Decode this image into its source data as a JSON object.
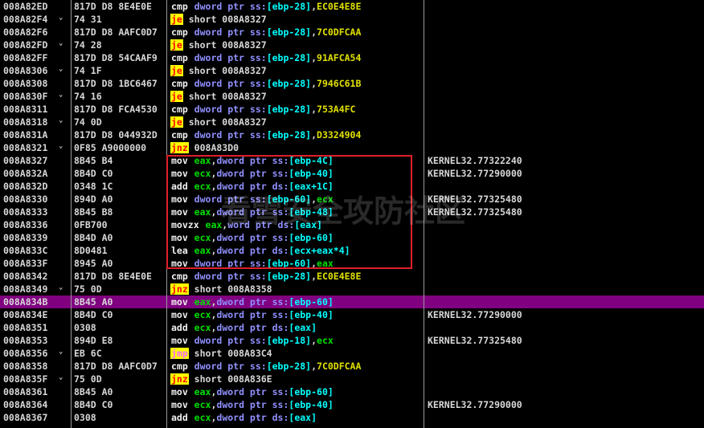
{
  "colors": {
    "background": "#000000",
    "text": "#d8d8d8",
    "selected_row": "#800080",
    "jump_bg": "#ffff00",
    "jump_fg": "#ff0000",
    "jump_alt_fg": "#ff66ff",
    "mov": "#f0f0f0",
    "register": "#00e000",
    "size": "#9090ff",
    "operand": "#00ffff",
    "imm": "#e0e000",
    "annotation_box": "#e0202a"
  },
  "watermark": "看雪安全攻防社区",
  "rows": [
    {
      "addr": "008A82ED",
      "hex": "817D D8 8E4E0E",
      "dis": [
        {
          "t": "cmp",
          "c": "#f0f0f0",
          "k": "mn"
        },
        {
          "t": " "
        },
        {
          "t": "dword ptr ss:",
          "c": "#9090ff"
        },
        {
          "t": "[ebp-28]",
          "c": "#00ffff"
        },
        {
          "t": ",",
          "c": "#d8d8d8"
        },
        {
          "t": "EC0E4E8E",
          "c": "#e0e000"
        }
      ],
      "comment": ""
    },
    {
      "addr": "008A82F4",
      "arrow": "⌄",
      "hex": "74 31",
      "dis": [
        {
          "t": "je",
          "c": "#ff0000",
          "bg": "#ffff00",
          "k": "mn"
        },
        {
          "t": " "
        },
        {
          "t": "short 008A8327",
          "c": "#d8d8d8"
        }
      ],
      "comment": ""
    },
    {
      "addr": "008A82F6",
      "hex": "817D D8 AAFC0D7",
      "dis": [
        {
          "t": "cmp",
          "c": "#f0f0f0",
          "k": "mn"
        },
        {
          "t": " "
        },
        {
          "t": "dword ptr ss:",
          "c": "#9090ff"
        },
        {
          "t": "[ebp-28]",
          "c": "#00ffff"
        },
        {
          "t": ",",
          "c": "#d8d8d8"
        },
        {
          "t": "7C0DFCAA",
          "c": "#e0e000"
        }
      ],
      "comment": ""
    },
    {
      "addr": "008A82FD",
      "arrow": "⌄",
      "hex": "74 28",
      "dis": [
        {
          "t": "je",
          "c": "#ff0000",
          "bg": "#ffff00",
          "k": "mn"
        },
        {
          "t": " "
        },
        {
          "t": "short 008A8327",
          "c": "#d8d8d8"
        }
      ],
      "comment": ""
    },
    {
      "addr": "008A82FF",
      "hex": "817D D8 54CAAF9",
      "dis": [
        {
          "t": "cmp",
          "c": "#f0f0f0",
          "k": "mn"
        },
        {
          "t": " "
        },
        {
          "t": "dword ptr ss:",
          "c": "#9090ff"
        },
        {
          "t": "[ebp-28]",
          "c": "#00ffff"
        },
        {
          "t": ",",
          "c": "#d8d8d8"
        },
        {
          "t": "91AFCA54",
          "c": "#e0e000"
        }
      ],
      "comment": ""
    },
    {
      "addr": "008A8306",
      "arrow": "⌄",
      "hex": "74 1F",
      "dis": [
        {
          "t": "je",
          "c": "#ff0000",
          "bg": "#ffff00",
          "k": "mn"
        },
        {
          "t": " "
        },
        {
          "t": "short 008A8327",
          "c": "#d8d8d8"
        }
      ],
      "comment": ""
    },
    {
      "addr": "008A8308",
      "hex": "817D D8 1BC6467",
      "dis": [
        {
          "t": "cmp",
          "c": "#f0f0f0",
          "k": "mn"
        },
        {
          "t": " "
        },
        {
          "t": "dword ptr ss:",
          "c": "#9090ff"
        },
        {
          "t": "[ebp-28]",
          "c": "#00ffff"
        },
        {
          "t": ",",
          "c": "#d8d8d8"
        },
        {
          "t": "7946C61B",
          "c": "#e0e000"
        }
      ],
      "comment": ""
    },
    {
      "addr": "008A830F",
      "arrow": "⌄",
      "hex": "74 16",
      "dis": [
        {
          "t": "je",
          "c": "#ff0000",
          "bg": "#ffff00",
          "k": "mn"
        },
        {
          "t": " "
        },
        {
          "t": "short 008A8327",
          "c": "#d8d8d8"
        }
      ],
      "comment": ""
    },
    {
      "addr": "008A8311",
      "hex": "817D D8 FCA4530",
      "dis": [
        {
          "t": "cmp",
          "c": "#f0f0f0",
          "k": "mn"
        },
        {
          "t": " "
        },
        {
          "t": "dword ptr ss:",
          "c": "#9090ff"
        },
        {
          "t": "[ebp-28]",
          "c": "#00ffff"
        },
        {
          "t": ",",
          "c": "#d8d8d8"
        },
        {
          "t": "753A4FC",
          "c": "#e0e000"
        }
      ],
      "comment": ""
    },
    {
      "addr": "008A8318",
      "arrow": "⌄",
      "hex": "74 0D",
      "dis": [
        {
          "t": "je",
          "c": "#ff0000",
          "bg": "#ffff00",
          "k": "mn"
        },
        {
          "t": " "
        },
        {
          "t": "short 008A8327",
          "c": "#d8d8d8"
        }
      ],
      "comment": ""
    },
    {
      "addr": "008A831A",
      "hex": "817D D8 044932D",
      "dis": [
        {
          "t": "cmp",
          "c": "#f0f0f0",
          "k": "mn"
        },
        {
          "t": " "
        },
        {
          "t": "dword ptr ss:",
          "c": "#9090ff"
        },
        {
          "t": "[ebp-28]",
          "c": "#00ffff"
        },
        {
          "t": ",",
          "c": "#d8d8d8"
        },
        {
          "t": "D3324904",
          "c": "#e0e000"
        }
      ],
      "comment": ""
    },
    {
      "addr": "008A8321",
      "arrow": "⌄",
      "hex": "0F85 A9000000",
      "dis": [
        {
          "t": "jnz",
          "c": "#ff0000",
          "bg": "#ffff00",
          "k": "mn"
        },
        {
          "t": " "
        },
        {
          "t": "008A83D0",
          "c": "#d8d8d8"
        }
      ],
      "comment": ""
    },
    {
      "addr": "008A8327",
      "hex": "8B45 B4",
      "dis": [
        {
          "t": "mov",
          "c": "#f0f0f0",
          "k": "mn"
        },
        {
          "t": " "
        },
        {
          "t": "eax",
          "c": "#00e000"
        },
        {
          "t": ",",
          "c": "#d8d8d8"
        },
        {
          "t": "dword ptr ss:",
          "c": "#9090ff"
        },
        {
          "t": "[ebp-4C]",
          "c": "#00ffff"
        }
      ],
      "comment": "KERNEL32.77322240"
    },
    {
      "addr": "008A832A",
      "hex": "8B4D C0",
      "dis": [
        {
          "t": "mov",
          "c": "#f0f0f0",
          "k": "mn"
        },
        {
          "t": " "
        },
        {
          "t": "ecx",
          "c": "#00e000"
        },
        {
          "t": ",",
          "c": "#d8d8d8"
        },
        {
          "t": "dword ptr ss:",
          "c": "#9090ff"
        },
        {
          "t": "[ebp-40]",
          "c": "#00ffff"
        }
      ],
      "comment": "KERNEL32.77290000"
    },
    {
      "addr": "008A832D",
      "hex": "0348 1C",
      "dis": [
        {
          "t": "add",
          "c": "#f0f0f0",
          "k": "mn"
        },
        {
          "t": " "
        },
        {
          "t": "ecx",
          "c": "#00e000"
        },
        {
          "t": ",",
          "c": "#d8d8d8"
        },
        {
          "t": "dword ptr ds:",
          "c": "#9090ff"
        },
        {
          "t": "[eax+1C]",
          "c": "#00ffff"
        }
      ],
      "comment": ""
    },
    {
      "addr": "008A8330",
      "hex": "894D A0",
      "dis": [
        {
          "t": "mov",
          "c": "#f0f0f0",
          "k": "mn"
        },
        {
          "t": " "
        },
        {
          "t": "dword ptr ss:",
          "c": "#9090ff"
        },
        {
          "t": "[ebp-60]",
          "c": "#00ffff"
        },
        {
          "t": ",",
          "c": "#d8d8d8"
        },
        {
          "t": "ecx",
          "c": "#00e000"
        }
      ],
      "comment": "KERNEL32.77325480"
    },
    {
      "addr": "008A8333",
      "hex": "8B45 B8",
      "dis": [
        {
          "t": "mov",
          "c": "#f0f0f0",
          "k": "mn"
        },
        {
          "t": " "
        },
        {
          "t": "eax",
          "c": "#00e000"
        },
        {
          "t": ",",
          "c": "#d8d8d8"
        },
        {
          "t": "dword ptr ss:",
          "c": "#9090ff"
        },
        {
          "t": "[ebp-48]",
          "c": "#00ffff"
        }
      ],
      "comment": "KERNEL32.77325480"
    },
    {
      "addr": "008A8336",
      "hex": "0FB700",
      "dis": [
        {
          "t": "movzx",
          "c": "#f0f0f0",
          "k": "mn"
        },
        {
          "t": " "
        },
        {
          "t": "eax",
          "c": "#00e000"
        },
        {
          "t": ",",
          "c": "#d8d8d8"
        },
        {
          "t": "word ptr ds:",
          "c": "#9090ff"
        },
        {
          "t": "[eax]",
          "c": "#00ffff"
        }
      ],
      "comment": ""
    },
    {
      "addr": "008A8339",
      "hex": "8B4D A0",
      "dis": [
        {
          "t": "mov",
          "c": "#f0f0f0",
          "k": "mn"
        },
        {
          "t": " "
        },
        {
          "t": "ecx",
          "c": "#00e000"
        },
        {
          "t": ",",
          "c": "#d8d8d8"
        },
        {
          "t": "dword ptr ss:",
          "c": "#9090ff"
        },
        {
          "t": "[ebp-60]",
          "c": "#00ffff"
        }
      ],
      "comment": ""
    },
    {
      "addr": "008A833C",
      "hex": "8D0481",
      "dis": [
        {
          "t": "lea",
          "c": "#f0f0f0",
          "k": "mn"
        },
        {
          "t": " "
        },
        {
          "t": "eax",
          "c": "#00e000"
        },
        {
          "t": ",",
          "c": "#d8d8d8"
        },
        {
          "t": "dword ptr ds:",
          "c": "#9090ff"
        },
        {
          "t": "[ecx+eax*4]",
          "c": "#00ffff"
        }
      ],
      "comment": ""
    },
    {
      "addr": "008A833F",
      "hex": "8945 A0",
      "dis": [
        {
          "t": "mov",
          "c": "#f0f0f0",
          "k": "mn"
        },
        {
          "t": " "
        },
        {
          "t": "dword ptr ss:",
          "c": "#9090ff"
        },
        {
          "t": "[ebp-60]",
          "c": "#00ffff"
        },
        {
          "t": ",",
          "c": "#d8d8d8"
        },
        {
          "t": "eax",
          "c": "#00e000"
        }
      ],
      "comment": ""
    },
    {
      "addr": "008A8342",
      "hex": "817D D8 8E4E0E",
      "dis": [
        {
          "t": "cmp",
          "c": "#f0f0f0",
          "k": "mn"
        },
        {
          "t": " "
        },
        {
          "t": "dword ptr ss:",
          "c": "#9090ff"
        },
        {
          "t": "[ebp-28]",
          "c": "#00ffff"
        },
        {
          "t": ",",
          "c": "#d8d8d8"
        },
        {
          "t": "EC0E4E8E",
          "c": "#e0e000"
        }
      ],
      "comment": ""
    },
    {
      "addr": "008A8349",
      "arrow": "⌄",
      "hex": "75 0D",
      "dis": [
        {
          "t": "jnz",
          "c": "#ff0000",
          "bg": "#ffff00",
          "k": "mn"
        },
        {
          "t": " "
        },
        {
          "t": "short 008A8358",
          "c": "#d8d8d8"
        }
      ],
      "comment": ""
    },
    {
      "addr": "008A834B",
      "selected": true,
      "hex": "8B45 A0",
      "dis": [
        {
          "t": "mov",
          "c": "#f0f0f0",
          "k": "mn"
        },
        {
          "t": " "
        },
        {
          "t": "eax",
          "c": "#00e000"
        },
        {
          "t": ",",
          "c": "#d8d8d8"
        },
        {
          "t": "dword ptr ss:",
          "c": "#9090ff"
        },
        {
          "t": "[ebp-60]",
          "c": "#00ffff"
        }
      ],
      "comment": ""
    },
    {
      "addr": "008A834E",
      "hex": "8B4D C0",
      "dis": [
        {
          "t": "mov",
          "c": "#f0f0f0",
          "k": "mn"
        },
        {
          "t": " "
        },
        {
          "t": "ecx",
          "c": "#00e000"
        },
        {
          "t": ",",
          "c": "#d8d8d8"
        },
        {
          "t": "dword ptr ss:",
          "c": "#9090ff"
        },
        {
          "t": "[ebp-40]",
          "c": "#00ffff"
        }
      ],
      "comment": "KERNEL32.77290000"
    },
    {
      "addr": "008A8351",
      "hex": "0308",
      "dis": [
        {
          "t": "add",
          "c": "#f0f0f0",
          "k": "mn"
        },
        {
          "t": " "
        },
        {
          "t": "ecx",
          "c": "#00e000"
        },
        {
          "t": ",",
          "c": "#d8d8d8"
        },
        {
          "t": "dword ptr ds:",
          "c": "#9090ff"
        },
        {
          "t": "[eax]",
          "c": "#00ffff"
        }
      ],
      "comment": ""
    },
    {
      "addr": "008A8353",
      "hex": "894D E8",
      "dis": [
        {
          "t": "mov",
          "c": "#f0f0f0",
          "k": "mn"
        },
        {
          "t": " "
        },
        {
          "t": "dword ptr ss:",
          "c": "#9090ff"
        },
        {
          "t": "[ebp-18]",
          "c": "#00ffff"
        },
        {
          "t": ",",
          "c": "#d8d8d8"
        },
        {
          "t": "ecx",
          "c": "#00e000"
        }
      ],
      "comment": "KERNEL32.77325480"
    },
    {
      "addr": "008A8356",
      "arrow": "⌄",
      "hex": "EB 6C",
      "dis": [
        {
          "t": "jmp",
          "c": "#ff66ff",
          "bg": "#ffff00",
          "k": "mn"
        },
        {
          "t": " "
        },
        {
          "t": "short 008A83C4",
          "c": "#d8d8d8"
        }
      ],
      "comment": ""
    },
    {
      "addr": "008A8358",
      "hex": "817D D8 AAFC0D7",
      "dis": [
        {
          "t": "cmp",
          "c": "#f0f0f0",
          "k": "mn"
        },
        {
          "t": " "
        },
        {
          "t": "dword ptr ss:",
          "c": "#9090ff"
        },
        {
          "t": "[ebp-28]",
          "c": "#00ffff"
        },
        {
          "t": ",",
          "c": "#d8d8d8"
        },
        {
          "t": "7C0DFCAA",
          "c": "#e0e000"
        }
      ],
      "comment": ""
    },
    {
      "addr": "008A835F",
      "arrow": "⌄",
      "hex": "75 0D",
      "dis": [
        {
          "t": "jnz",
          "c": "#ff0000",
          "bg": "#ffff00",
          "k": "mn"
        },
        {
          "t": " "
        },
        {
          "t": "short 008A836E",
          "c": "#d8d8d8"
        }
      ],
      "comment": ""
    },
    {
      "addr": "008A8361",
      "hex": "8B45 A0",
      "dis": [
        {
          "t": "mov",
          "c": "#f0f0f0",
          "k": "mn"
        },
        {
          "t": " "
        },
        {
          "t": "eax",
          "c": "#00e000"
        },
        {
          "t": ",",
          "c": "#d8d8d8"
        },
        {
          "t": "dword ptr ss:",
          "c": "#9090ff"
        },
        {
          "t": "[ebp-60]",
          "c": "#00ffff"
        }
      ],
      "comment": ""
    },
    {
      "addr": "008A8364",
      "hex": "8B4D C0",
      "dis": [
        {
          "t": "mov",
          "c": "#f0f0f0",
          "k": "mn"
        },
        {
          "t": " "
        },
        {
          "t": "ecx",
          "c": "#00e000"
        },
        {
          "t": ",",
          "c": "#d8d8d8"
        },
        {
          "t": "dword ptr ss:",
          "c": "#9090ff"
        },
        {
          "t": "[ebp-40]",
          "c": "#00ffff"
        }
      ],
      "comment": "KERNEL32.77290000"
    },
    {
      "addr": "008A8367",
      "hex": "0308",
      "dis": [
        {
          "t": "add",
          "c": "#f0f0f0",
          "k": "mn"
        },
        {
          "t": " "
        },
        {
          "t": "ecx",
          "c": "#00e000"
        },
        {
          "t": ",",
          "c": "#d8d8d8"
        },
        {
          "t": "dword ptr ds:",
          "c": "#9090ff"
        },
        {
          "t": "[eax]",
          "c": "#00ffff"
        }
      ],
      "comment": ""
    }
  ]
}
